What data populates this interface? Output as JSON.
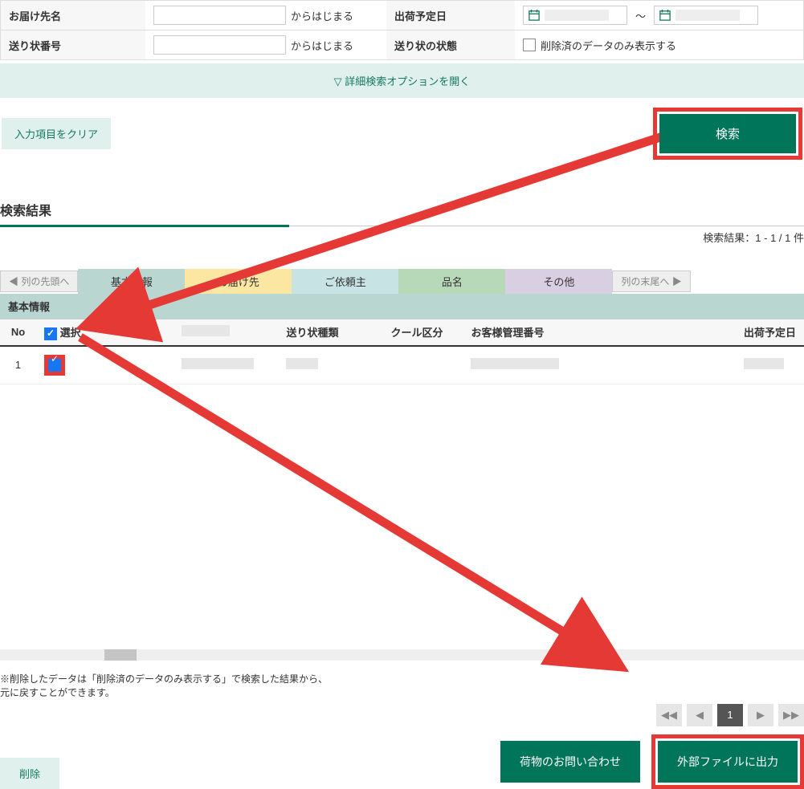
{
  "form": {
    "recipient": {
      "label": "お届け先名",
      "suffix": "からはじまる"
    },
    "tracking": {
      "label": "送り状番号",
      "suffix": "からはじまる"
    },
    "shipDate": {
      "label": "出荷予定日",
      "sep": "～"
    },
    "status": {
      "label": "送り状の状態",
      "checkboxLabel": "削除済のデータのみ表示する"
    },
    "advancedToggle": " 詳細検索オプションを開く",
    "clearBtn": "入力項目をクリア",
    "searchBtn": "検索"
  },
  "results": {
    "title": "検索結果",
    "countText": "検索結果：1 - 1 / 1 件",
    "navStart": " 列の先頭へ",
    "navEnd": "列の末尾へ ",
    "tabs": [
      "基本情報",
      "お届け先",
      "ご依頼主",
      "品名",
      "その他"
    ],
    "groupHeader": "基本情報",
    "columns": [
      "No",
      "選択",
      "",
      "送り状種類",
      "クール区分",
      "お客様管理番号",
      "出荷予定日"
    ],
    "rows": [
      {
        "no": "1"
      }
    ]
  },
  "footer": {
    "noteLine1": "※削除したデータは「削除済のデータのみ表示する」で検索した結果から、",
    "noteLine2": "元に戻すことができます。",
    "deleteBtn": "削除",
    "currentPage": "1",
    "inquiryBtn": "荷物のお問い合わせ",
    "exportBtn": "外部ファイルに出力"
  }
}
